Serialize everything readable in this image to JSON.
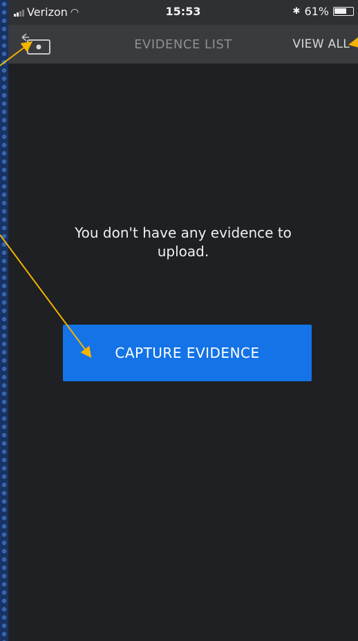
{
  "status_bar": {
    "carrier": "Verizon",
    "time": "15:53",
    "battery_percent": "61%",
    "bluetooth_glyph": "✱",
    "wifi_glyph": "◠",
    "battery_level": 0.61
  },
  "nav": {
    "back_icon": "back-camera-icon",
    "title": "EVIDENCE LIST",
    "view_all_label": "VIEW ALL"
  },
  "main": {
    "empty_message": "You don't have any evidence to upload.",
    "capture_button_label": "CAPTURE EVIDENCE"
  },
  "colors": {
    "accent": "#1473e6",
    "background": "#1f2023",
    "navbar": "#3a3b3e",
    "annotation_arrow": "#f5b400",
    "outer_frame": "#173364"
  }
}
